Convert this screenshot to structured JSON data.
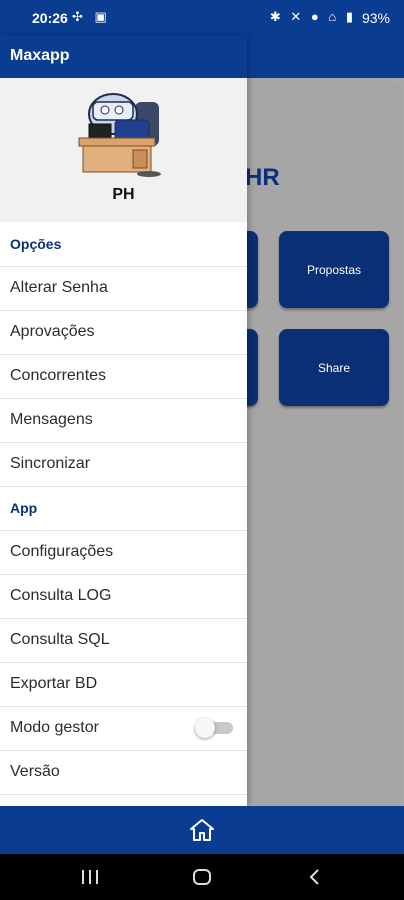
{
  "status": {
    "time": "20:26",
    "left_icons": "✣ ▣",
    "right_icons": "✱ ✕ ● ⌂ ▮",
    "battery": "93%"
  },
  "app": {
    "title": "Maxapp"
  },
  "main": {
    "heading": "HR",
    "tiles": [
      "Propostas",
      "Share"
    ]
  },
  "drawer": {
    "username": "PH",
    "sections": [
      {
        "header": "Opções",
        "items": [
          "Alterar Senha",
          "Aprovações",
          "Concorrentes",
          "Mensagens",
          "Sincronizar"
        ]
      },
      {
        "header": "App",
        "items": [
          "Configurações",
          "Consulta LOG",
          "Consulta SQL",
          "Exportar BD",
          "Modo gestor",
          "Versão"
        ]
      }
    ],
    "modo_gestor_on": false
  },
  "colors": {
    "primary": "#0a3d91",
    "tile": "#0a2f74",
    "section": "#0b2f78"
  },
  "icons": {
    "home": "home-icon",
    "recents": "recents-icon",
    "nav_home": "nav-home-icon",
    "back": "back-icon"
  }
}
